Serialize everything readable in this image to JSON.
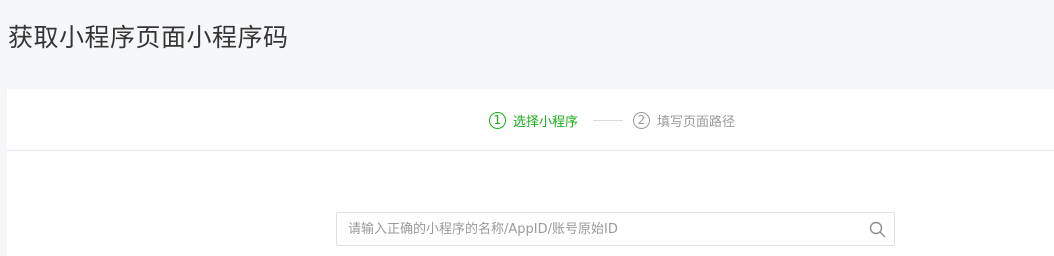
{
  "page": {
    "title": "获取小程序页面小程序码"
  },
  "steps": [
    {
      "number": "1",
      "label": "选择小程序",
      "state": "active"
    },
    {
      "number": "2",
      "label": "填写页面路径",
      "state": "inactive"
    }
  ],
  "search": {
    "placeholder": "请输入正确的小程序的名称/AppID/账号原始ID",
    "value": "",
    "icon": "search-icon"
  },
  "colors": {
    "accent": "#1aad19",
    "inactive": "#9a9a9a",
    "page_bg": "#f6f7f9",
    "card_bg": "#ffffff",
    "title": "#353535",
    "border": "#e7e7eb"
  }
}
